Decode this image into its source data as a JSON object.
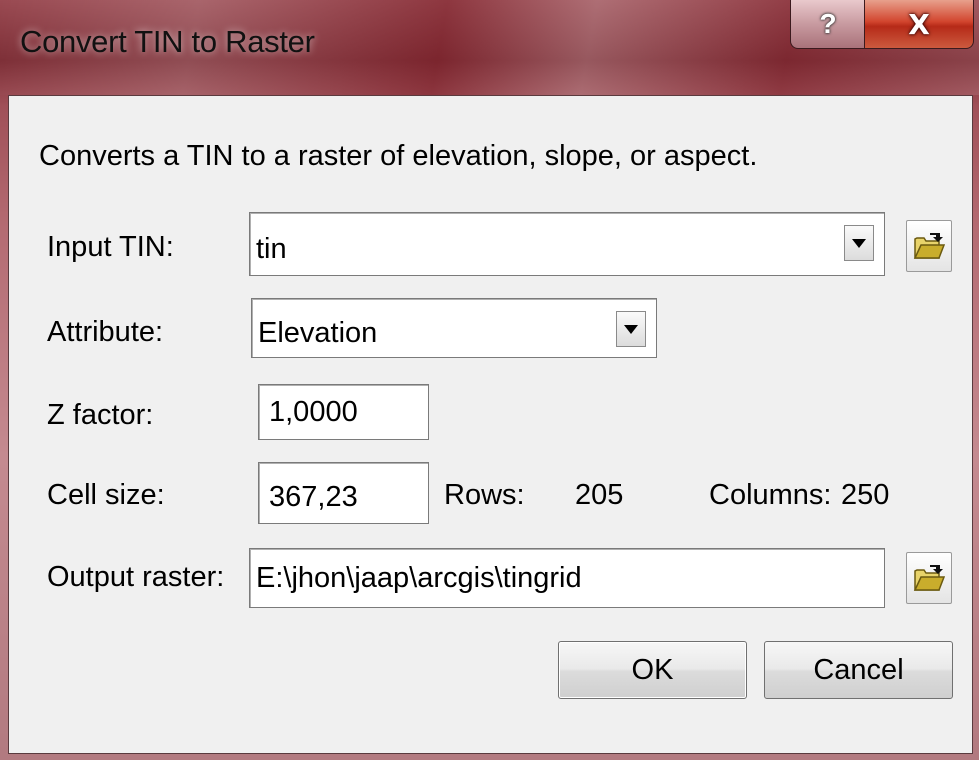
{
  "window": {
    "title": "Convert TIN to Raster",
    "help_label": "?",
    "close_label": "X"
  },
  "description": "Converts a TIN to a raster of elevation, slope, or aspect.",
  "input_tin": {
    "label": "Input TIN:",
    "value": "tin"
  },
  "attribute": {
    "label": "Attribute:",
    "value": "Elevation"
  },
  "z_factor": {
    "label": "Z factor:",
    "value": "1,0000"
  },
  "cell_size": {
    "label": "Cell size:",
    "value": "367,23",
    "rows_label": "Rows:",
    "rows_value": "205",
    "columns_label": "Columns:",
    "columns_value": "250"
  },
  "output_raster": {
    "label": "Output raster:",
    "value": "E:\\jhon\\jaap\\arcgis\\tingrid"
  },
  "buttons": {
    "ok": "OK",
    "cancel": "Cancel"
  },
  "icons": {
    "browse": "open-folder-icon",
    "dropdown": "chevron-down-icon"
  },
  "colors": {
    "close_button": "#cc3a24",
    "dialog_background": "#f0f0f0"
  }
}
